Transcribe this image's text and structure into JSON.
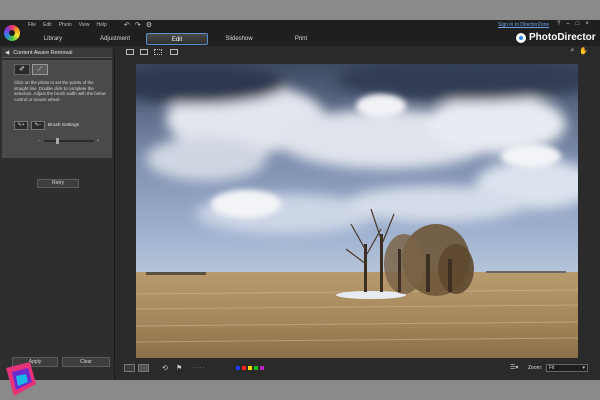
{
  "menu": [
    "File",
    "Edit",
    "Photo",
    "View",
    "Help"
  ],
  "main_tabs": [
    {
      "label": "Library"
    },
    {
      "label": "Adjustment"
    },
    {
      "label": "Edit"
    },
    {
      "label": "Slideshow"
    },
    {
      "label": "Print"
    }
  ],
  "active_tab": "Edit",
  "signin": "Sign in to DirectorZone",
  "window_controls": [
    "?",
    "–",
    "□",
    "×"
  ],
  "brand": "PhotoDirector",
  "panel": {
    "title": "Content Aware Removal",
    "instructions": "Click on the photo to set the points of the straight line. Double click to complete the selection. Adjust the brush width with the below control or mouse wheel.",
    "brush_settings": "Brush Settings",
    "retry": "Retry",
    "apply": "Apply",
    "clear": "Clear"
  },
  "bottom_bar": {
    "zoom_label": "Zoom:",
    "zoom_value": "Fit",
    "colors": [
      "#1e3cff",
      "#ff2020",
      "#ffd400",
      "#20c020",
      "#c020c0"
    ]
  },
  "watermark_colors": {
    "pink": "#e8327a",
    "purple": "#6a2bd0",
    "cyan": "#19b8e6"
  }
}
